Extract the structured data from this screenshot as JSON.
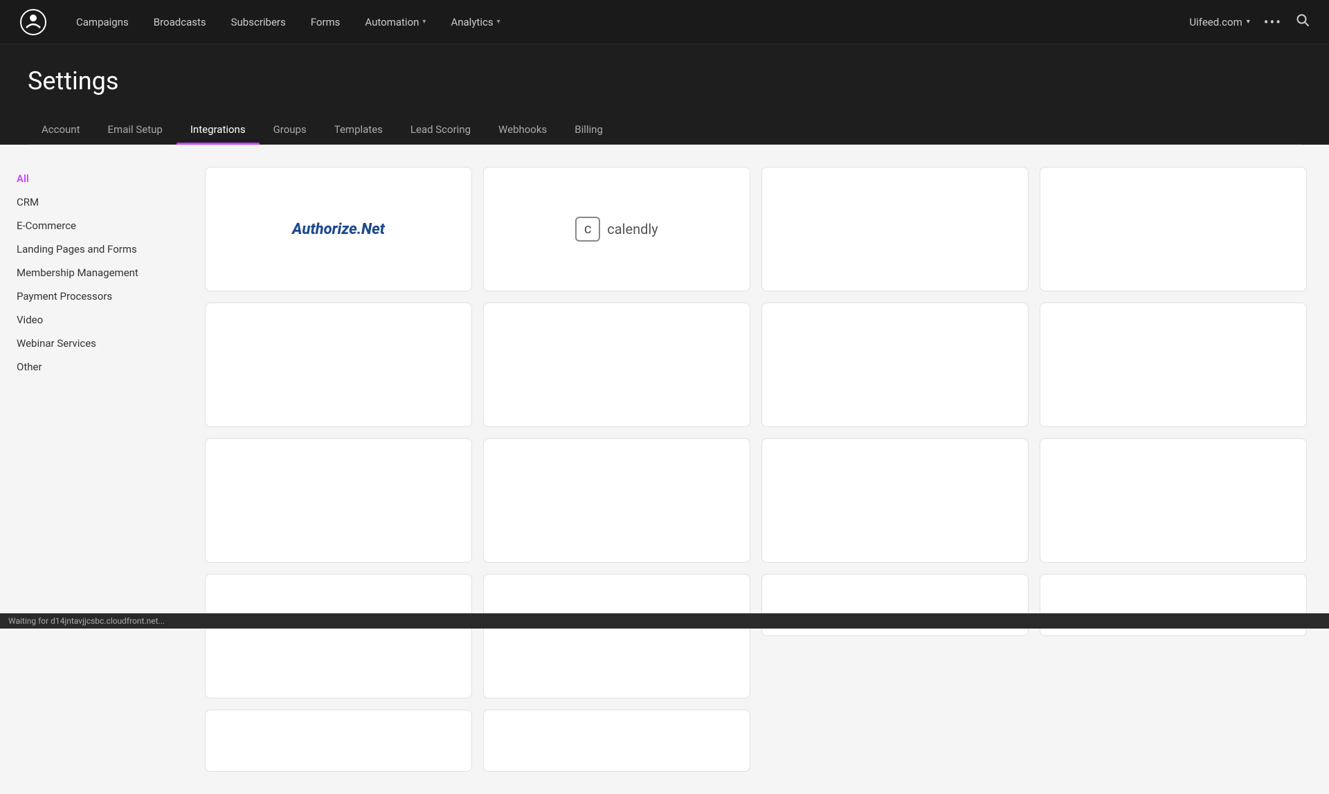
{
  "navbar": {
    "logo_alt": "Uifeed logo",
    "links": [
      {
        "label": "Campaigns",
        "has_dropdown": false
      },
      {
        "label": "Broadcasts",
        "has_dropdown": false
      },
      {
        "label": "Subscribers",
        "has_dropdown": false
      },
      {
        "label": "Forms",
        "has_dropdown": false
      },
      {
        "label": "Automation",
        "has_dropdown": true
      },
      {
        "label": "Analytics",
        "has_dropdown": true
      }
    ],
    "site_name": "Uifeed.com",
    "dots": "•••"
  },
  "page": {
    "title": "Settings"
  },
  "tabs": [
    {
      "label": "Account",
      "active": false
    },
    {
      "label": "Email Setup",
      "active": false
    },
    {
      "label": "Integrations",
      "active": true
    },
    {
      "label": "Groups",
      "active": false
    },
    {
      "label": "Templates",
      "active": false
    },
    {
      "label": "Lead Scoring",
      "active": false
    },
    {
      "label": "Webhooks",
      "active": false
    },
    {
      "label": "Billing",
      "active": false
    }
  ],
  "sidebar": {
    "items": [
      {
        "label": "All",
        "active": true
      },
      {
        "label": "CRM",
        "active": false
      },
      {
        "label": "E-Commerce",
        "active": false
      },
      {
        "label": "Landing Pages and Forms",
        "active": false
      },
      {
        "label": "Membership Management",
        "active": false
      },
      {
        "label": "Payment Processors",
        "active": false
      },
      {
        "label": "Video",
        "active": false
      },
      {
        "label": "Webinar Services",
        "active": false
      },
      {
        "label": "Other",
        "active": false
      }
    ]
  },
  "integrations": {
    "cards": [
      {
        "id": 0,
        "type": "authorize_net",
        "name": "Authorize Net"
      },
      {
        "id": 1,
        "type": "calendly",
        "name": "Calendly"
      },
      {
        "id": 2,
        "type": "empty",
        "name": ""
      },
      {
        "id": 3,
        "type": "empty",
        "name": ""
      },
      {
        "id": 4,
        "type": "empty",
        "name": ""
      },
      {
        "id": 5,
        "type": "empty",
        "name": ""
      },
      {
        "id": 6,
        "type": "empty",
        "name": ""
      },
      {
        "id": 7,
        "type": "empty",
        "name": ""
      },
      {
        "id": 8,
        "type": "empty",
        "name": ""
      },
      {
        "id": 9,
        "type": "empty",
        "name": ""
      },
      {
        "id": 10,
        "type": "empty",
        "name": ""
      },
      {
        "id": 11,
        "type": "empty",
        "name": ""
      },
      {
        "id": 12,
        "type": "empty",
        "name": ""
      },
      {
        "id": 13,
        "type": "empty",
        "name": ""
      },
      {
        "id": 14,
        "type": "empty",
        "name": ""
      },
      {
        "id": 15,
        "type": "empty",
        "name": ""
      }
    ]
  },
  "status_bar": {
    "text": "Waiting for d14jntavjjcsbc.cloudfront.net..."
  }
}
